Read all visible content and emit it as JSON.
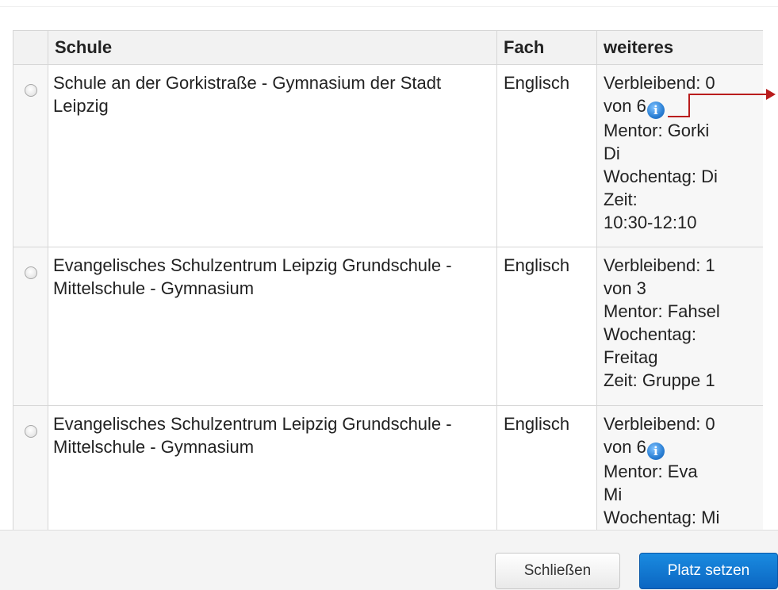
{
  "table": {
    "headers": {
      "school": "Schule",
      "subject": "Fach",
      "more": "weiteres"
    },
    "rows": [
      {
        "school": "Schule an der Gorkistraße - Gymnasium der Stadt Leipzig",
        "subject": "Englisch",
        "remaining_a": "Verbleibend: 0",
        "remaining_b": "von 6",
        "mentor_a": "Mentor: Gorki",
        "mentor_b": "Di",
        "weekday_a": "Wochentag: Di",
        "weekday_b": "",
        "time_a": "Zeit:",
        "time_b": "10:30-12:10"
      },
      {
        "school": "Evangelisches Schulzentrum Leipzig Grundschule - Mittelschule - Gymnasium",
        "subject": "Englisch",
        "remaining_a": "Verbleibend: 1",
        "remaining_b": "von 3",
        "mentor_a": "Mentor: Fahsel",
        "weekday_a": "Wochentag:",
        "weekday_b": "Freitag",
        "time_a": "Zeit: Gruppe 1"
      },
      {
        "school": "Evangelisches Schulzentrum Leipzig Grundschule - Mittelschule - Gymnasium",
        "subject": "Englisch",
        "remaining_a": "Verbleibend: 0",
        "remaining_b": "von 6",
        "mentor_a": "Mentor: Eva",
        "mentor_b": "Mi",
        "weekday_a": "Wochentag: Mi"
      }
    ]
  },
  "info_icon_glyph": "i",
  "buttons": {
    "close": "Schließen",
    "set_place": "Platz setzen"
  },
  "colors": {
    "primary": "#0b66c2",
    "arrow": "#b91c1c",
    "info_icon": "#2a7fd4"
  }
}
